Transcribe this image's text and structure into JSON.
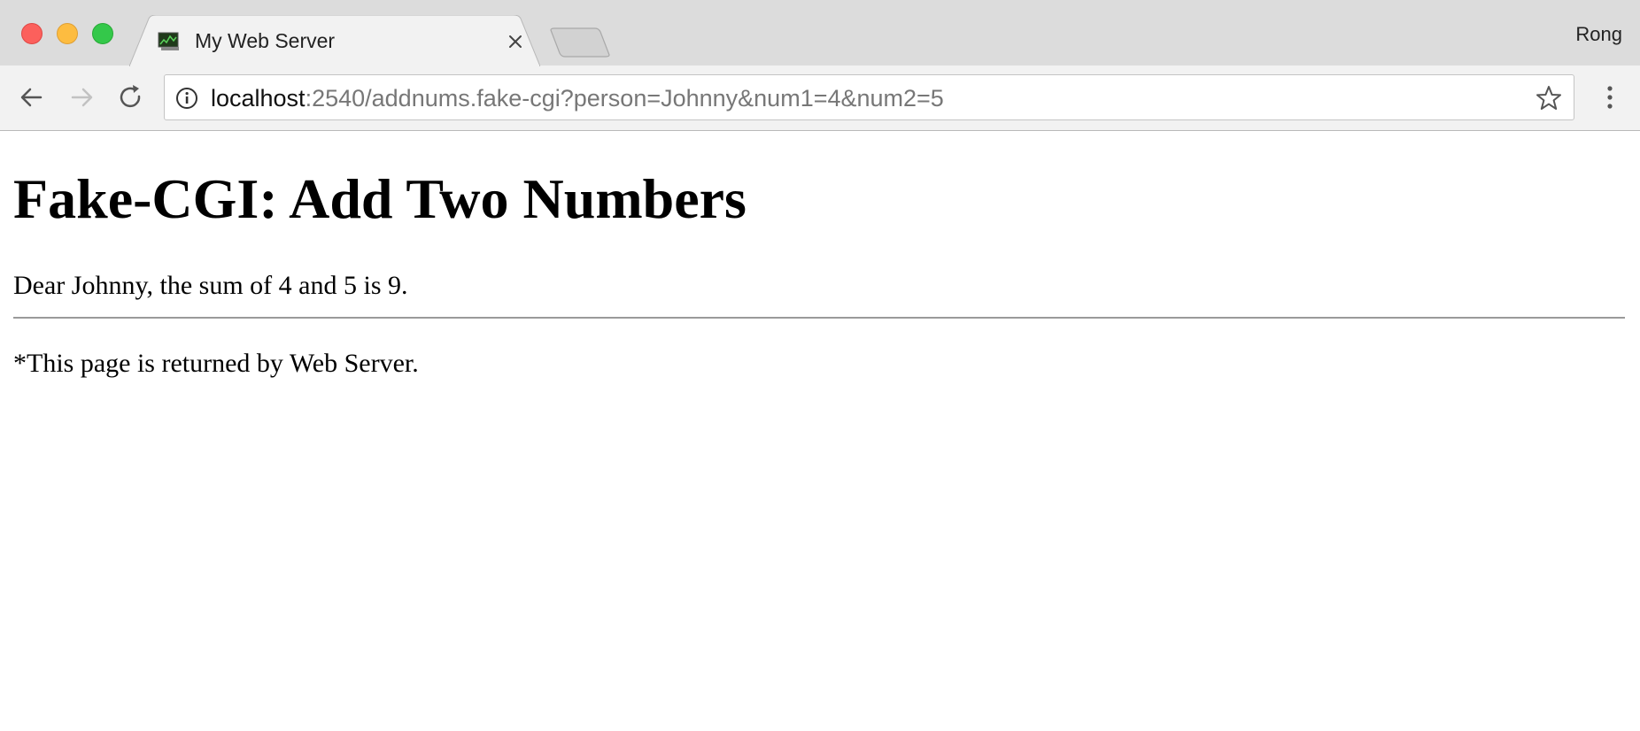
{
  "tab": {
    "title": "My Web Server",
    "favicon_icon": "monitor-chart-icon"
  },
  "profile": {
    "name": "Rong"
  },
  "address_bar": {
    "host": "localhost",
    "path": ":2540/addnums.fake-cgi?person=Johnny&num1=4&num2=5"
  },
  "page": {
    "title": "Fake-CGI: Add Two Numbers",
    "result": "Dear Johnny, the sum of 4 and 5 is 9.",
    "footer": "*This page is returned by Web Server."
  },
  "colors": {
    "traffic_close": "#fc605c",
    "traffic_minimize": "#fdbc40",
    "traffic_maximize": "#34c84a",
    "tabstrip_bg": "#dcdcdc",
    "toolbar_bg": "#f2f2f2"
  }
}
